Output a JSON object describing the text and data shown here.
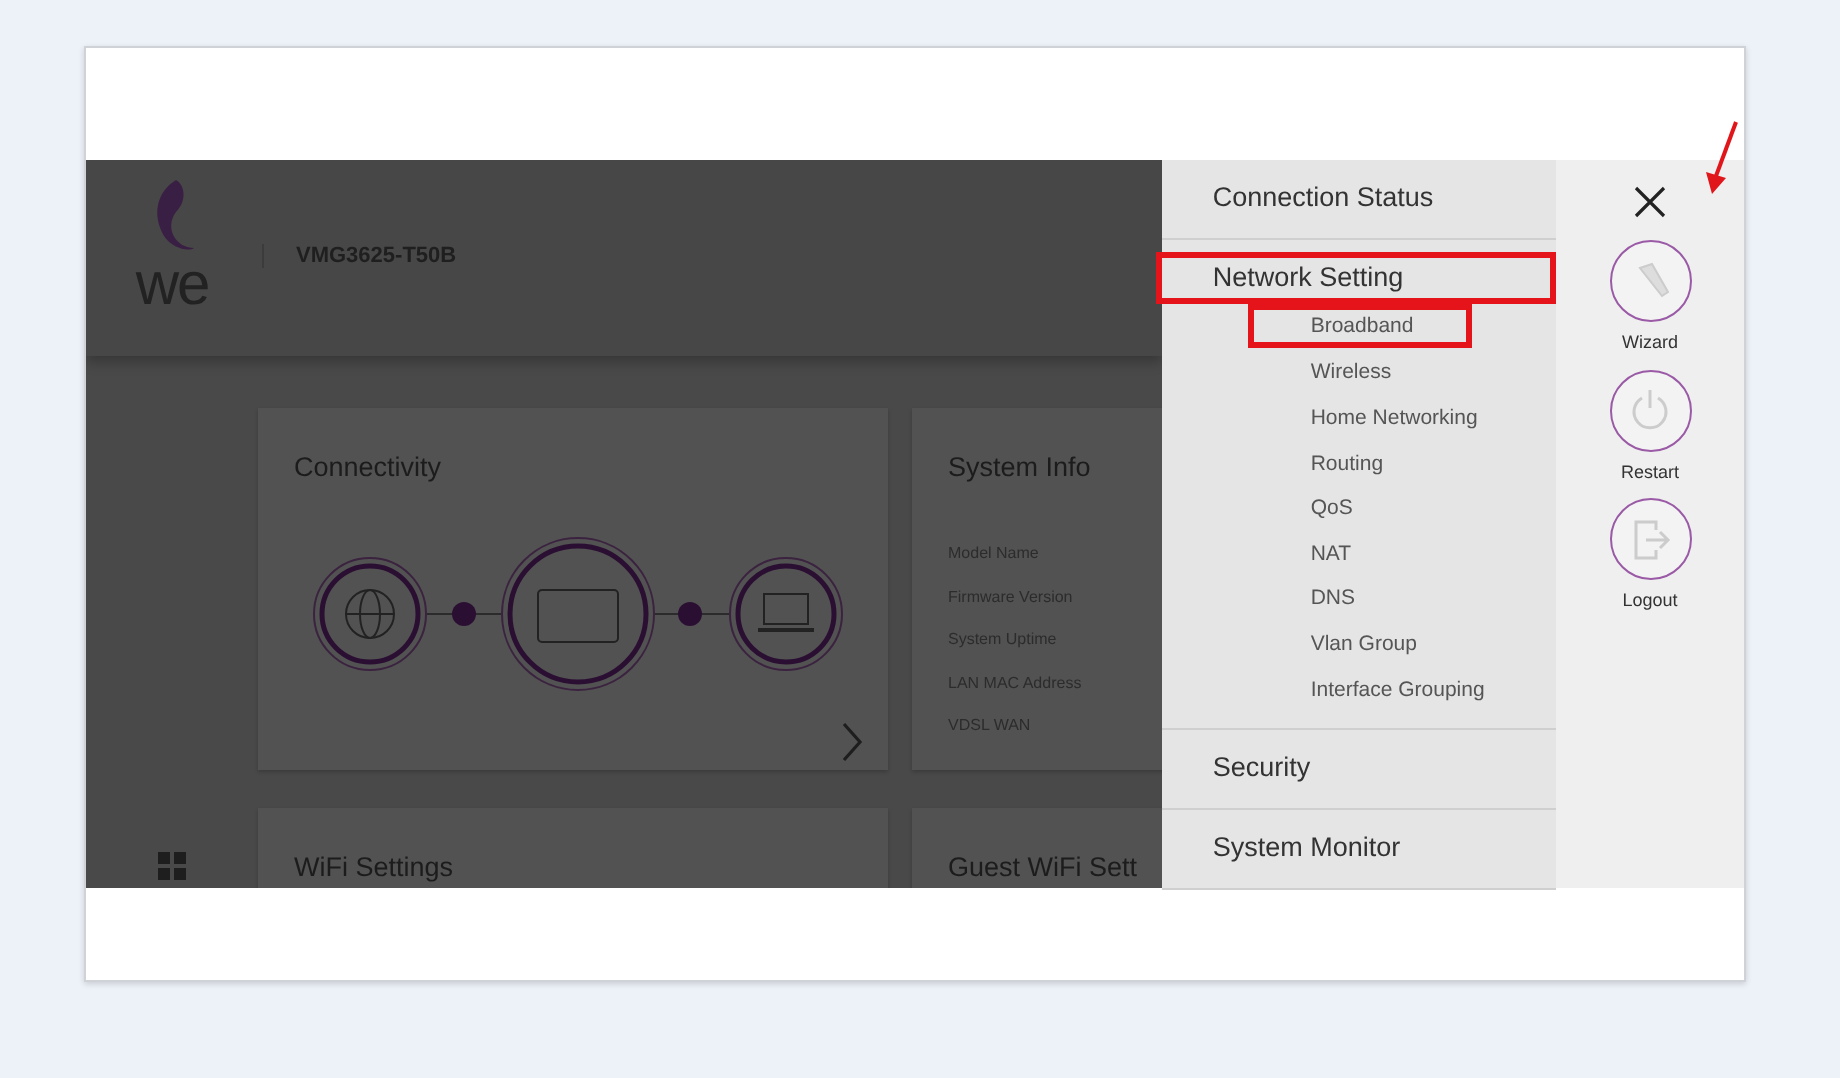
{
  "header": {
    "logo_text": "we",
    "model": "VMG3625-T50B"
  },
  "cards": [
    {
      "kind": "connectivity",
      "title": "Connectivity"
    },
    {
      "kind": "info",
      "title": "System Info",
      "fields": [
        "Model Name",
        "Firmware Version",
        "System Uptime",
        "LAN MAC Address",
        "VDSL WAN"
      ]
    },
    {
      "kind": "plain",
      "title": "WiFi Settings"
    },
    {
      "kind": "plain",
      "title": "Guest WiFi Sett"
    }
  ],
  "menu": [
    {
      "label": "Connection Status",
      "highlighted": false
    },
    {
      "label": "Network Setting",
      "highlighted": true,
      "children": [
        {
          "label": "Broadband",
          "highlighted": true
        },
        {
          "label": "Wireless",
          "highlighted": false
        },
        {
          "label": "Home Networking",
          "highlighted": false
        },
        {
          "label": "Routing",
          "highlighted": false
        },
        {
          "label": "QoS",
          "highlighted": false
        },
        {
          "label": "NAT",
          "highlighted": false
        },
        {
          "label": "DNS",
          "highlighted": false
        },
        {
          "label": "Vlan Group",
          "highlighted": false
        },
        {
          "label": "Interface Grouping",
          "highlighted": false
        }
      ]
    },
    {
      "label": "Security",
      "highlighted": false
    },
    {
      "label": "System Monitor",
      "highlighted": false
    }
  ],
  "actions": [
    {
      "kind": "wizard",
      "label": "Wizard"
    },
    {
      "kind": "restart",
      "label": "Restart"
    },
    {
      "kind": "logout",
      "label": "Logout"
    }
  ]
}
